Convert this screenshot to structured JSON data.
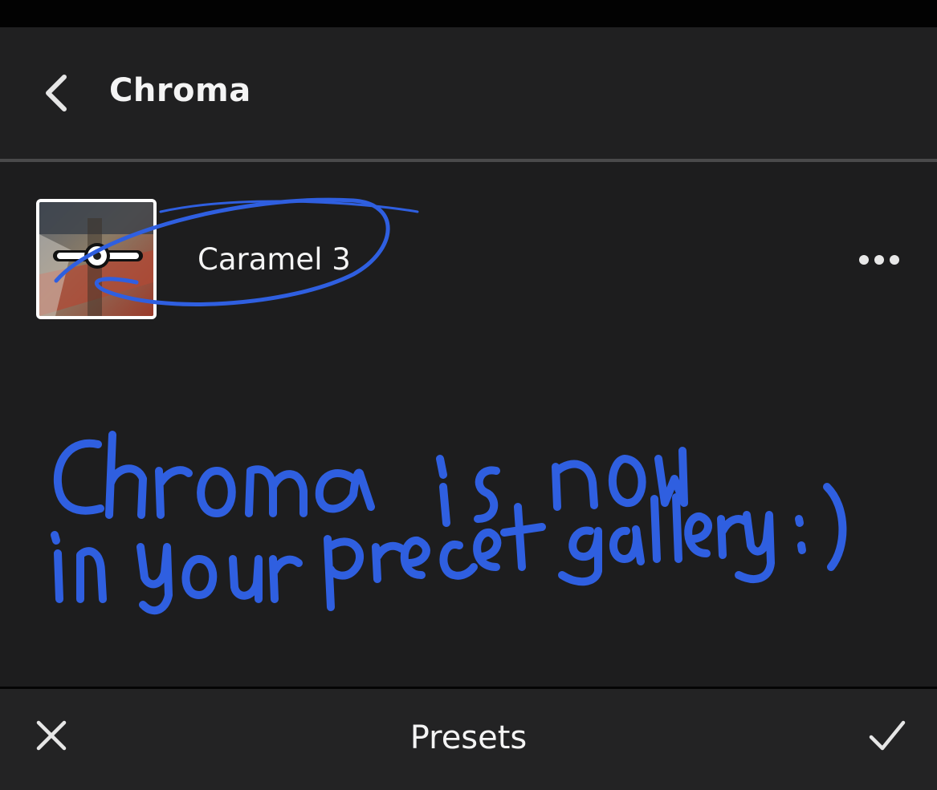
{
  "header": {
    "title": "Chroma",
    "back_icon": "chevron-left-icon"
  },
  "preset": {
    "name": "Caramel 3",
    "thumbnail_icon": "preset-thumbnail",
    "more_icon": "more-horizontal-icon"
  },
  "annotation": {
    "line1": "Chroma is now",
    "line2": "in your preset gallery :)",
    "color": "#2f5fe0"
  },
  "bottom_bar": {
    "title": "Presets",
    "cancel_icon": "close-icon",
    "confirm_icon": "checkmark-icon"
  },
  "colors": {
    "background": "#1d1d1e",
    "header_background": "#202021",
    "text": "#f4f4f4",
    "annotation_blue": "#2f5fe0"
  }
}
